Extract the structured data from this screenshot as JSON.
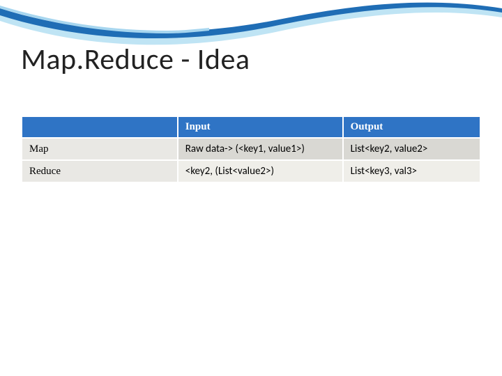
{
  "slide": {
    "title": "Map.Reduce - Idea"
  },
  "table": {
    "headers": {
      "blank": "",
      "input": "Input",
      "output": "Output"
    },
    "rows": [
      {
        "label": "Map",
        "input": "Raw data-> (<key1, value1>)",
        "output": "List<key2, value2>"
      },
      {
        "label": "Reduce",
        "input": "<key2, (List<value2>)",
        "output": "List<key3, val3>"
      }
    ]
  },
  "theme": {
    "accent": "#2f74c5",
    "wave_light": "#a7d6ef",
    "wave_dark": "#1f6db5"
  }
}
